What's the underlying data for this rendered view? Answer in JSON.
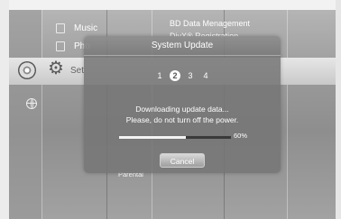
{
  "left_menu": [
    {
      "label": "Music",
      "icon": "music-file-icon"
    },
    {
      "label": "Pho",
      "icon": "photo-file-icon"
    },
    {
      "label": "Set",
      "icon": "gear-icon"
    }
  ],
  "right_menu": [
    "BD Data Menagement",
    "DivX® Registration"
  ],
  "behind_label": "Parental",
  "dialog": {
    "title": "System Update",
    "steps": [
      "1",
      "2",
      "3",
      "4"
    ],
    "active_step": "2",
    "message_line1": "Downloading update data...",
    "message_line2": "Please, do not turn off the power.",
    "progress_percent": 60,
    "progress_label": "60%",
    "cancel_label": "Cancel"
  },
  "colors": {
    "dialog_bg": "#767676",
    "selected_band": "#d9d9d9",
    "progress_fill": "#f2f2f2"
  }
}
